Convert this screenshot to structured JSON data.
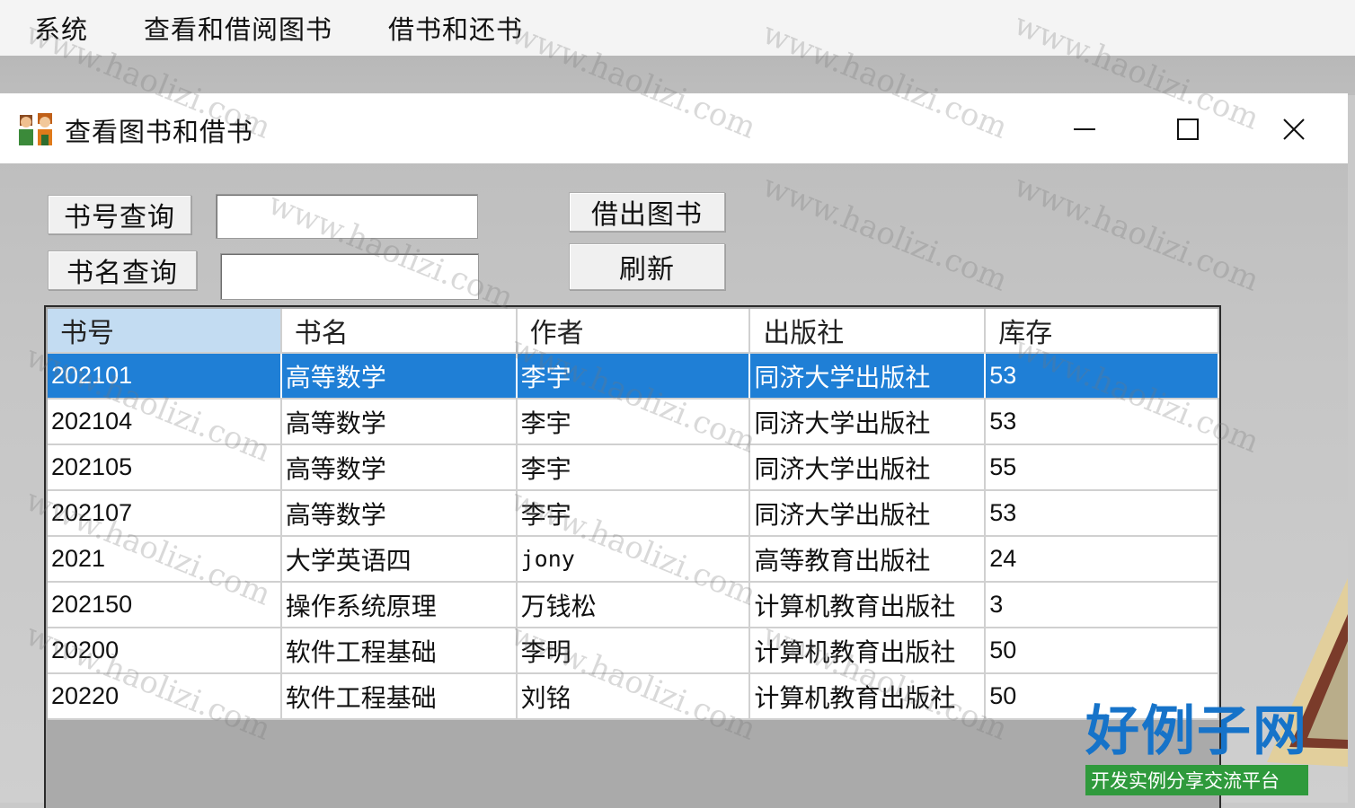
{
  "menubar": {
    "items": [
      "系统",
      "查看和借阅图书",
      "借书和还书"
    ]
  },
  "window": {
    "title": "查看图书和借书",
    "controls": {
      "minimize": "—",
      "maximize": "☐",
      "close": "✕"
    }
  },
  "form": {
    "query_by_id_label": "书号查询",
    "query_by_id_value": "",
    "query_by_name_label": "书名查询",
    "query_by_name_value": "",
    "borrow_label": "借出图书",
    "refresh_label": "刷新"
  },
  "table": {
    "columns": [
      "书号",
      "书名",
      "作者",
      "出版社",
      "库存"
    ],
    "selected_row_index": 0,
    "rows": [
      [
        "202101",
        "高等数学",
        "李宇",
        "同济大学出版社",
        "53"
      ],
      [
        "202104",
        "高等数学",
        "李宇",
        "同济大学出版社",
        "53"
      ],
      [
        "202105",
        "高等数学",
        "李宇",
        "同济大学出版社",
        "55"
      ],
      [
        "202107",
        "高等数学",
        "李宇",
        "同济大学出版社",
        "53"
      ],
      [
        "2021",
        "大学英语四",
        "jony",
        "高等教育出版社",
        "24"
      ],
      [
        "202150",
        "操作系统原理",
        "万钱松",
        "计算机教育出版社",
        "3"
      ],
      [
        "20200",
        "软件工程基础",
        "李明",
        "计算机教育出版社",
        "50"
      ],
      [
        "20220",
        "软件工程基础",
        "刘铭",
        "计算机教育出版社",
        "50"
      ]
    ]
  },
  "watermark": {
    "text": "www.haolizi.com",
    "brand_name": "好例子网",
    "brand_tagline": "开发实例分享交流平台"
  },
  "colors": {
    "selection": "#1f7fd6",
    "header_selected": "#c3dcf2",
    "brand_blue": "#1673c9",
    "brand_green": "#2f9a3c"
  }
}
